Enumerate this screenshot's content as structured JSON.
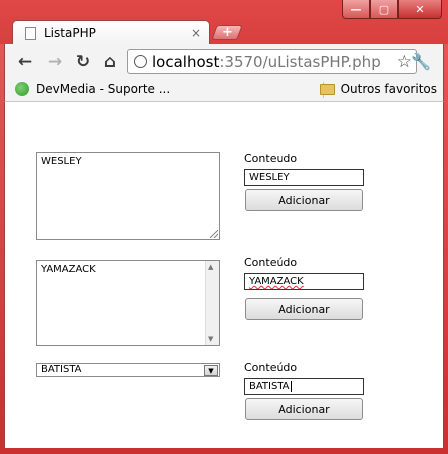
{
  "browser": {
    "tab_title": "ListaPHP",
    "tab_close": "×",
    "newtab_label": "+",
    "url_host": "localhost",
    "url_rest": ":3570/uListasPHP.php",
    "bookmark_left": "DevMedia - Suporte ...",
    "bookmark_right": "Outros favoritos"
  },
  "form": {
    "rows": [
      {
        "field_value": "WESLEY",
        "label": "Conteudo",
        "input_value": "WESLEY",
        "button_label": "Adicionar"
      },
      {
        "field_value": "YAMAZACK",
        "label": "Conteúdo",
        "input_value": "YAMAZACK",
        "button_label": "Adicionar"
      },
      {
        "field_value": "BATISTA",
        "label": "Conteúdo",
        "input_value": "BATISTA",
        "button_label": "Adicionar"
      }
    ]
  },
  "icons": {
    "window": [
      "minimize-icon",
      "maximize-icon",
      "close-icon"
    ],
    "nav": [
      "back-arrow-icon",
      "forward-arrow-icon",
      "reload-icon",
      "home-icon"
    ],
    "omnibox": [
      "page-info-icon",
      "star-icon"
    ],
    "toolbar": [
      "wrench-icon"
    ],
    "form": [
      "resize-grip-icon",
      "scroll-up-arrow-icon",
      "scroll-down-arrow-icon",
      "dropdown-arrow-icon"
    ]
  },
  "colors": {
    "frame": "#d84040",
    "toolbar_bg": "#f3f3f3",
    "content_bg": "#ffffff"
  }
}
